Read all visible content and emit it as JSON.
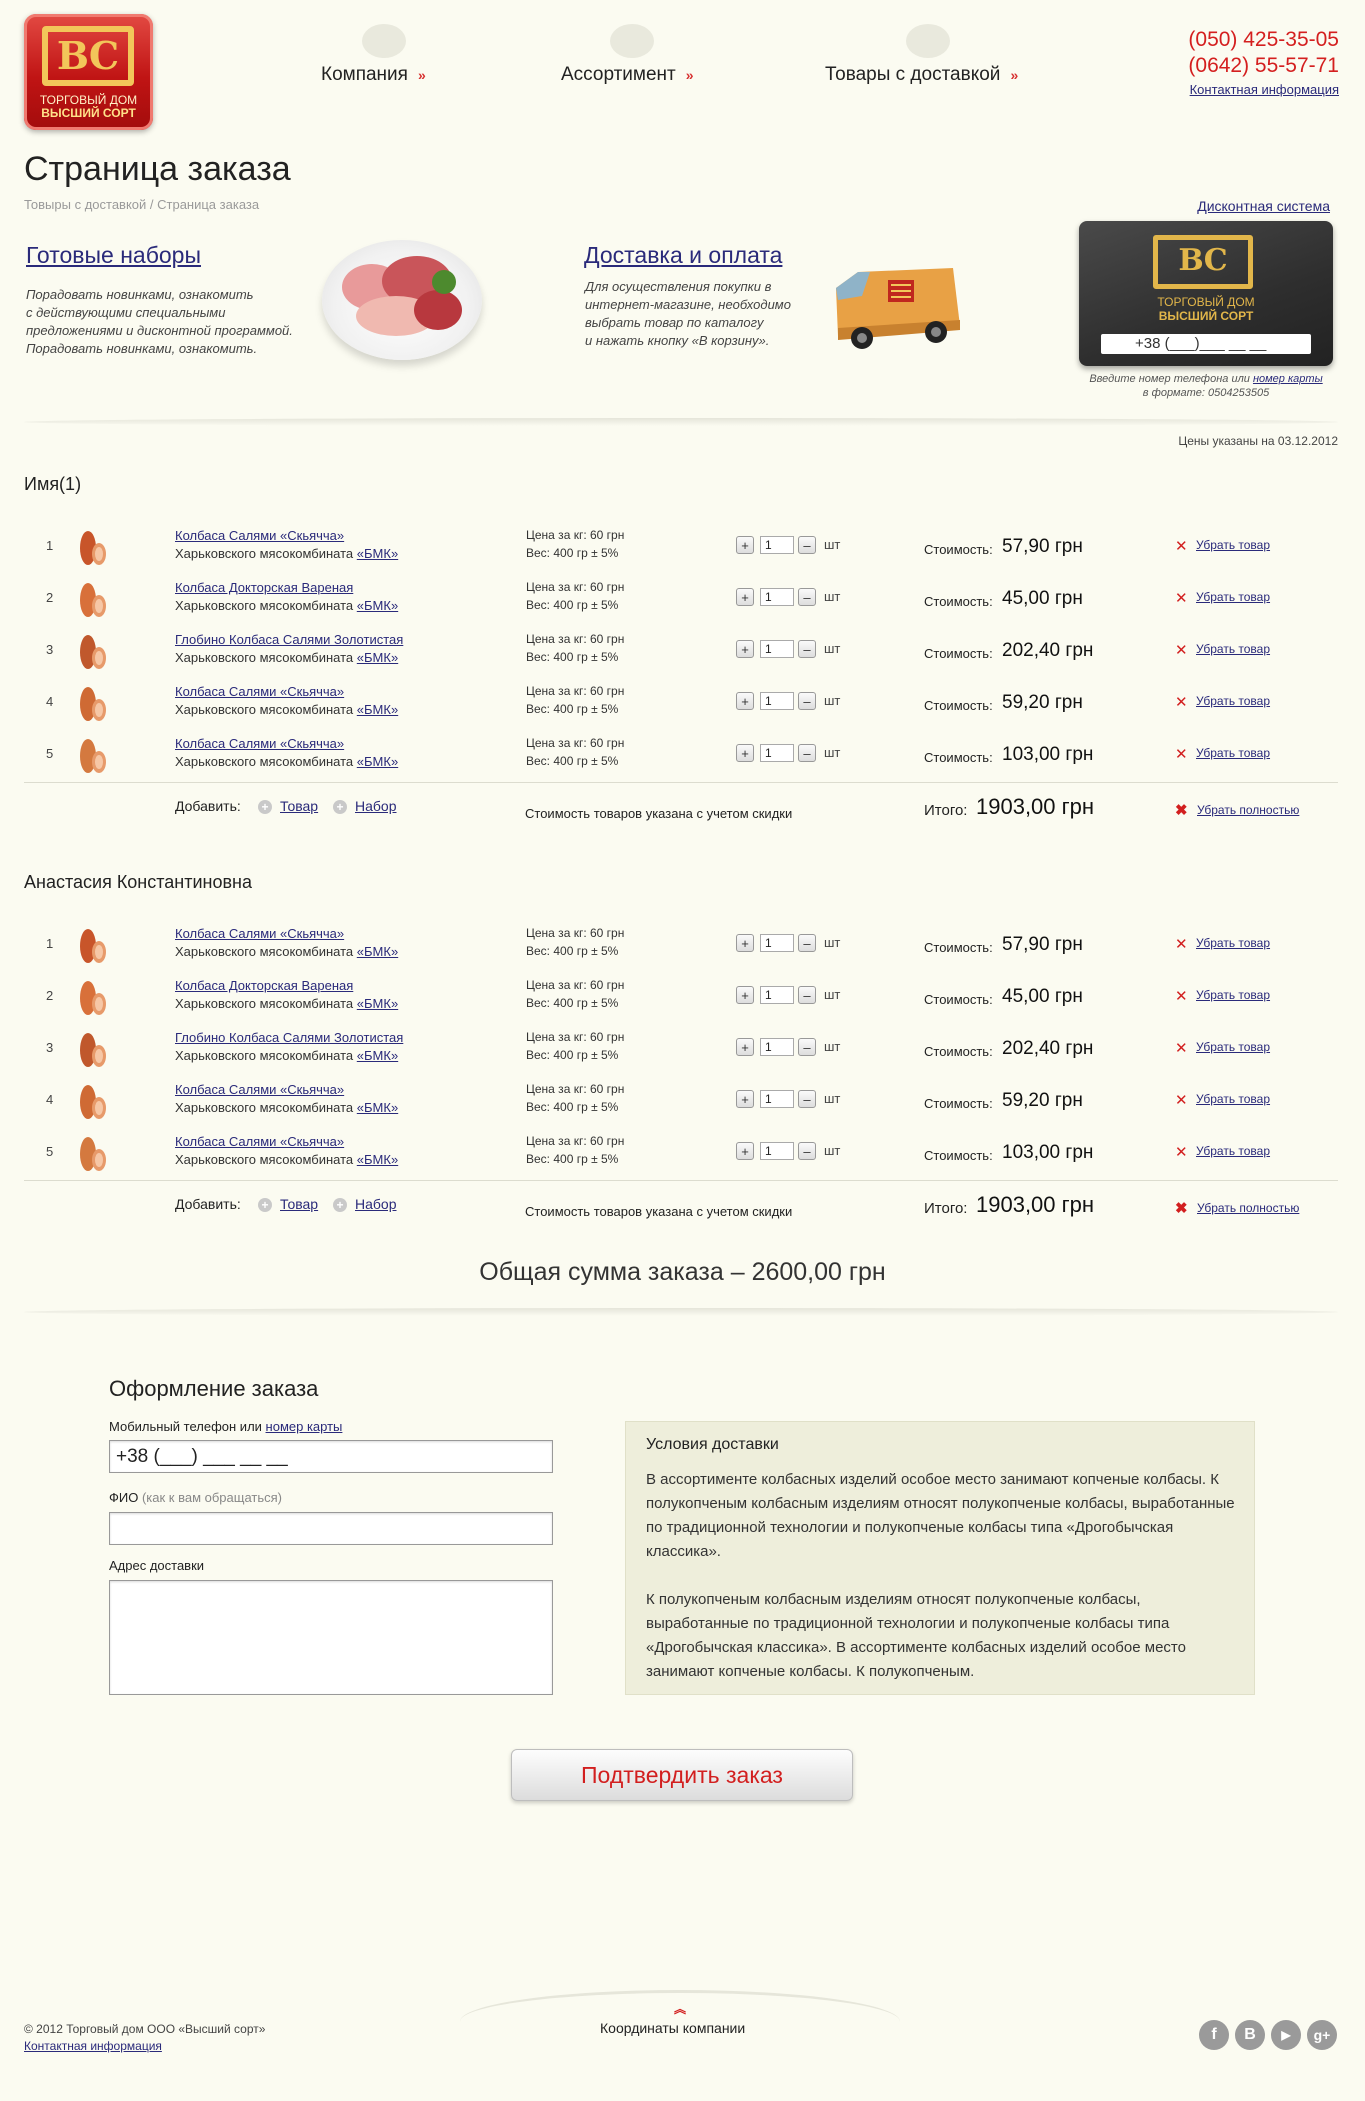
{
  "logo": {
    "mono": "ВС",
    "line1": "ТОРГОВЫЙ ДОМ",
    "line2": "ВЫСШИЙ СОРТ"
  },
  "nav": [
    {
      "label": "Компания",
      "icon": "chevron-double-down-icon"
    },
    {
      "label": "Ассортимент",
      "icon": "chevron-double-down-icon"
    },
    {
      "label": "Товары с доставкой",
      "icon": "chevron-double-down-icon"
    }
  ],
  "contacts": {
    "phone1": "(050) 425-35-05",
    "phone2": "(0642) 55-57-71",
    "link": "Контактная информация"
  },
  "page": {
    "title": "Страница заказа",
    "breadcrumb": "Товыры с доставкой / Страница заказа"
  },
  "promos": [
    {
      "title": "Готовые наборы",
      "text_lines": [
        "Порадовать новинками, ознакомить",
        "с действующими специальными",
        "предложениями и дисконтной программой.",
        "Порадовать новинками, ознакомить."
      ]
    },
    {
      "title": "Доставка и оплата",
      "text_lines": [
        "Для осуществления покупки в",
        "интернет-магазине, необходимо",
        "выбрать товар по каталогу",
        "и нажать кнопку «В корзину»."
      ]
    }
  ],
  "discount": {
    "link": "Дисконтная система",
    "card_input": "+38 (___)___ __ __",
    "hint_prefix": "Введите номер телефона или ",
    "hint_link": "номер карты",
    "hint_line2": "в формате: 0504253505"
  },
  "prices_date": "Цены указаны на 03.12.2012",
  "common": {
    "maker_prefix": "Харьковского мясокомбината ",
    "maker_link": "«БМК»",
    "price_per_kg": "Цена за кг: 60 грн",
    "weight": "Вес: 400 гр ± 5%",
    "minus": "–",
    "plus": "+",
    "unit": "шт",
    "cost_label": "Стоимость:",
    "remove": "Убрать товар",
    "add_label": "Добавить:",
    "add_item": "Товар",
    "add_set": "Набор",
    "discount_note": "Стоимость товаров указана с учетом скидки",
    "total_label": "Итого:",
    "remove_all": "Убрать полностью"
  },
  "groups": [
    {
      "name": "Имя(1)",
      "total": "1903,00 грн",
      "items": [
        {
          "num": "1",
          "name": "Колбаса Салями «Скьячча»",
          "qty": "1",
          "cost": "57,90 грн"
        },
        {
          "num": "2",
          "name": "Колбаса Докторская Вареная",
          "qty": "1",
          "cost": "45,00 грн"
        },
        {
          "num": "3",
          "name": "Глобино Колбаса Салями Золотистая",
          "qty": "1",
          "cost": "202,40 грн"
        },
        {
          "num": "4",
          "name": "Колбаса Салями «Скьячча»",
          "qty": "1",
          "cost": "59,20 грн"
        },
        {
          "num": "5",
          "name": "Колбаса Салями «Скьячча»",
          "qty": "1",
          "cost": "103,00 грн"
        }
      ]
    },
    {
      "name": "Анастасия Константиновна",
      "total": "1903,00 грн",
      "items": [
        {
          "num": "1",
          "name": "Колбаса Салями «Скьячча»",
          "qty": "1",
          "cost": "57,90 грн"
        },
        {
          "num": "2",
          "name": "Колбаса Докторская Вареная",
          "qty": "1",
          "cost": "45,00 грн"
        },
        {
          "num": "3",
          "name": "Глобино Колбаса Салями Золотистая",
          "qty": "1",
          "cost": "202,40 грн"
        },
        {
          "num": "4",
          "name": "Колбаса Салями «Скьячча»",
          "qty": "1",
          "cost": "59,20 грн"
        },
        {
          "num": "5",
          "name": "Колбаса Салями «Скьячча»",
          "qty": "1",
          "cost": "103,00 грн"
        }
      ]
    }
  ],
  "grand_total": "Общая сумма заказа – 2600,00 грн",
  "checkout": {
    "title": "Оформление заказа",
    "phone_label": "Мобильный телефон или ",
    "phone_label_link": "номер карты",
    "phone_value": "+38 (___) ___ __ __",
    "name_label": "ФИО",
    "name_hint": " (как к вам обращаться)",
    "name_value": "",
    "address_label": "Адрес доставки",
    "address_value": ""
  },
  "delivery": {
    "title": "Условия доставки",
    "p1": "В ассортименте колбасных изделий особое место занимают копченые колбасы. К полукопченым колбасным изделиям относят полукопченые колбасы, выработанные по традиционной технологии и полукопченые колбасы типа «Дрогобычская классика».",
    "p2": "К полукопченым колбасным изделиям относят полукопченые колбасы, выработанные по традиционной технологии и полукопченые колбасы типа «Дрогобычская классика». В ассортименте колбасных изделий особое место занимают копченые колбасы. К полукопченым."
  },
  "confirm": "Подтвердить заказ",
  "footer": {
    "copyright": "© 2012 Торговый дом ООО «Высший сорт»",
    "contact": "Контактная информация",
    "coords": "Координаты компании",
    "socials": [
      {
        "icon": "facebook-icon",
        "glyph": "f"
      },
      {
        "icon": "vkontakte-icon",
        "glyph": "B"
      },
      {
        "icon": "youtube-icon",
        "glyph": "▶"
      },
      {
        "icon": "google-plus-icon",
        "glyph": "g+"
      }
    ]
  },
  "colors": {
    "accent_red": "#d21f1f",
    "link": "#2a2a7a",
    "box_bg": "#eeeedb"
  }
}
